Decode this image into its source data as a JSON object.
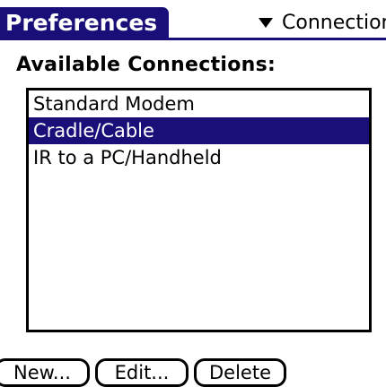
{
  "header": {
    "title": "Preferences",
    "category_label": "Connection",
    "category_icon": "triangle-down-icon",
    "accent_color": "#1a0f78"
  },
  "main": {
    "heading": "Available Connections:",
    "connections": [
      {
        "label": "Standard Modem",
        "selected": false
      },
      {
        "label": "Cradle/Cable",
        "selected": true
      },
      {
        "label": "IR to a PC/Handheld",
        "selected": false
      }
    ]
  },
  "buttons": {
    "new_label": "New...",
    "edit_label": "Edit...",
    "delete_label": "Delete"
  }
}
